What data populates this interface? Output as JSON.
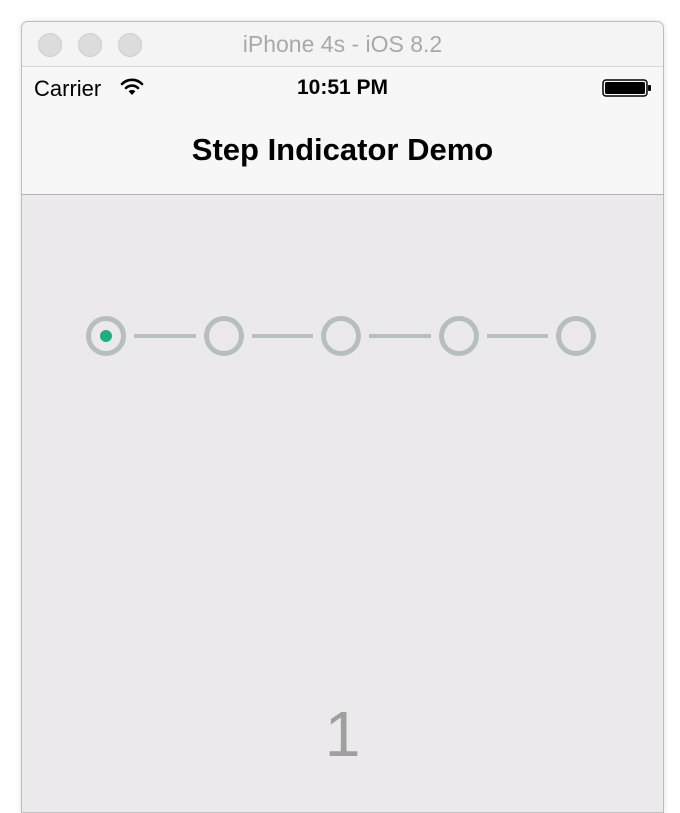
{
  "window": {
    "title": "iPhone 4s - iOS 8.2"
  },
  "statusbar": {
    "carrier": "Carrier",
    "time": "10:51 PM"
  },
  "navbar": {
    "title": "Step Indicator Demo"
  },
  "step_indicator": {
    "total_steps": 5,
    "current_step": 1,
    "colors": {
      "inactive": "#b6bec1",
      "active_dot": "#1fae7f"
    }
  },
  "content": {
    "page_number": "1"
  }
}
